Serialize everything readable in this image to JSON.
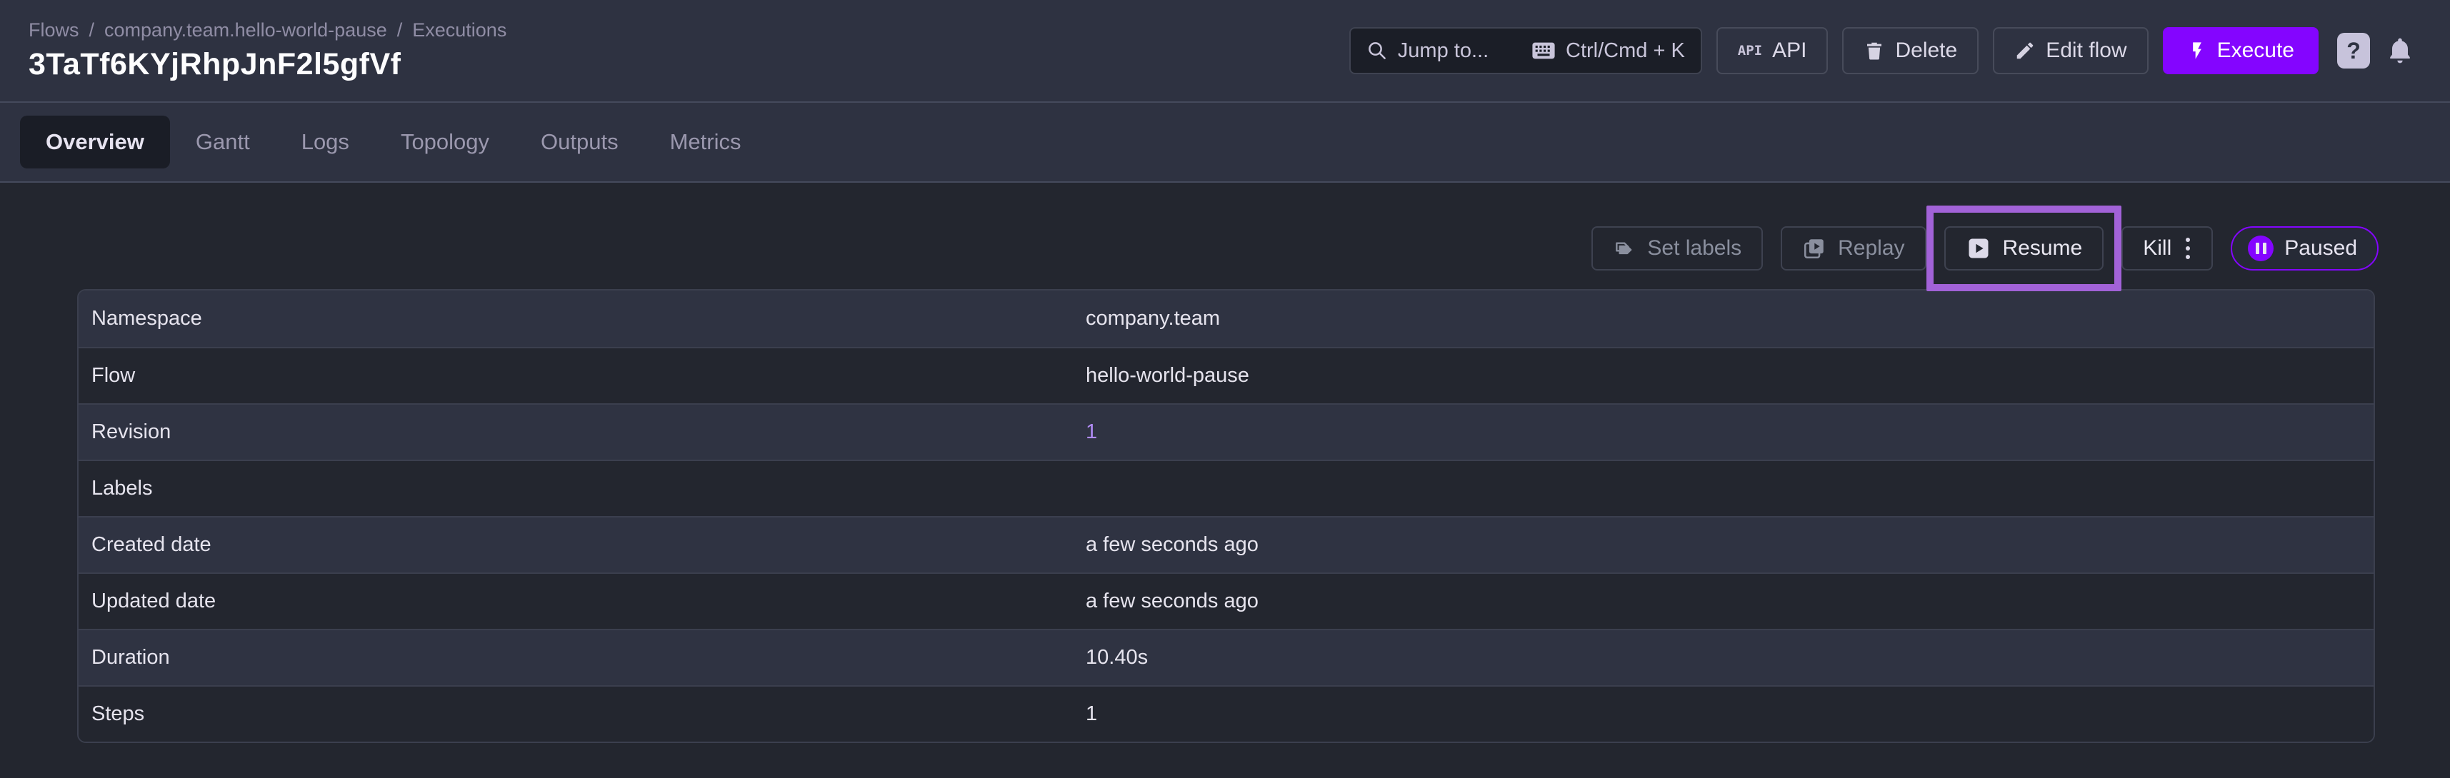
{
  "breadcrumb": {
    "separator": "/",
    "items": [
      "Flows",
      "company.team.hello-world-pause",
      "Executions"
    ]
  },
  "page": {
    "title": "3TaTf6KYjRhpJnF2l5gfVf"
  },
  "header": {
    "jump_to": {
      "placeholder": "Jump to...",
      "shortcut": "Ctrl/Cmd + K"
    },
    "api_icon_text": "API",
    "buttons": {
      "api": "API",
      "delete": "Delete",
      "edit_flow": "Edit flow",
      "execute": "Execute"
    },
    "help_glyph": "?"
  },
  "tabs": [
    {
      "label": "Overview",
      "active": true
    },
    {
      "label": "Gantt",
      "active": false
    },
    {
      "label": "Logs",
      "active": false
    },
    {
      "label": "Topology",
      "active": false
    },
    {
      "label": "Outputs",
      "active": false
    },
    {
      "label": "Metrics",
      "active": false
    }
  ],
  "actions": {
    "set_labels": "Set labels",
    "replay": "Replay",
    "resume": "Resume",
    "kill": "Kill",
    "status": "Paused"
  },
  "table": {
    "rows": [
      {
        "label": "Namespace",
        "value": "company.team"
      },
      {
        "label": "Flow",
        "value": "hello-world-pause"
      },
      {
        "label": "Revision",
        "value": "1",
        "link": true
      },
      {
        "label": "Labels",
        "value": ""
      },
      {
        "label": "Created date",
        "value": "a few seconds ago"
      },
      {
        "label": "Updated date",
        "value": "a few seconds ago"
      },
      {
        "label": "Duration",
        "value": "10.40s"
      },
      {
        "label": "Steps",
        "value": "1"
      }
    ]
  },
  "icons": {
    "search": "magnifier",
    "keyboard": "keyboard",
    "api_chip": "api-text-chip",
    "trash": "trash-can",
    "pencil": "pencil",
    "flash": "lightning-bolt",
    "help": "question-mark",
    "bell": "notification-bell",
    "tag": "label-tags",
    "replay": "play-box-multiple",
    "resume": "play-box",
    "dots": "dots-vertical",
    "pause": "pause-circle"
  },
  "colors": {
    "accent_purple": "#8405FF",
    "annotation_purple": "#A262D8",
    "link_purple": "#B18CF6",
    "header_bg": "#2E3241",
    "content_bg": "#23262F",
    "row_light": "#2F3342",
    "status_paused_border": "#8405FF"
  }
}
